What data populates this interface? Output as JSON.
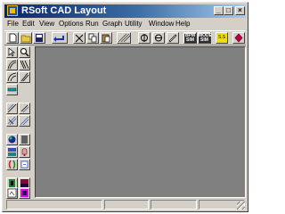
{
  "window": {
    "title": "RSoft CAD Layout",
    "minimize": "_",
    "maximize": "□",
    "close": "×"
  },
  "menu": [
    "File",
    "Edit",
    "View",
    "Options",
    "Run",
    "Graph",
    "Utility",
    "Window",
    "Help"
  ],
  "toolbar": {
    "buttons": [
      {
        "name": "new-file-icon"
      },
      {
        "name": "open-folder-icon"
      },
      {
        "name": "save-icon"
      },
      {
        "name": "undo-arrow-icon"
      },
      {
        "name": "cut-tool-icon"
      },
      {
        "name": "copy-tool-icon"
      },
      {
        "name": "paste-tool-icon"
      },
      {
        "name": "hatch-pattern-icon"
      },
      {
        "name": "rotate-left-icon"
      },
      {
        "name": "rotate-right-icon"
      },
      {
        "name": "edit-pen-icon"
      },
      {
        "name": "bpm-sim-icon",
        "text": "BPM SIM"
      },
      {
        "name": "mode-solver-icon",
        "text": "MODE SIM"
      },
      {
        "name": "scan-tool-icon",
        "text": "S.S"
      },
      {
        "name": "stop-icon"
      }
    ]
  },
  "palette": {
    "buttons": [
      "select-pointer-icon",
      "zoom-icon",
      "curved-guide-icon",
      "taper-guide-icon",
      "arc-guide-icon",
      "angled-guide-icon",
      "rectangle-segment-icon",
      "line-draw-icon",
      "edit-vertex-icon",
      "measure-icon",
      "dimension-icon",
      "sphere-icon",
      "block-icon",
      "layer-icon",
      "bell-icon",
      "bracket-icon",
      "refresh-icon",
      "text-color-icon",
      "gradient-icon",
      "layout-icon",
      "image-icon"
    ]
  },
  "colors": {
    "titlebar_start": "#0a246a",
    "titlebar_end": "#a6caf0",
    "face": "#d4d0c8",
    "canvas": "#808080"
  }
}
